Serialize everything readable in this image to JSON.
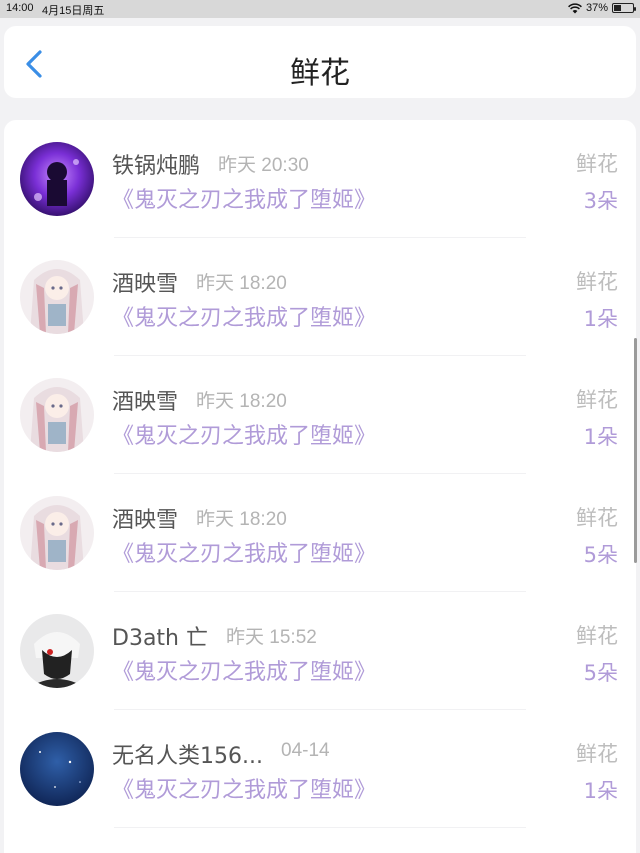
{
  "status_bar": {
    "time": "14:00",
    "date": "4月15日周五",
    "battery": "37%",
    "battery_level": 0.37
  },
  "header": {
    "title": "鲜花"
  },
  "entries": [
    {
      "name": "铁锅炖鹏",
      "time": "昨天 20:30",
      "book": "《鬼灭之刃之我成了堕姬》",
      "gift": "鲜花",
      "count": "3朵",
      "avatar_style": "purple-galaxy"
    },
    {
      "name": "酒映雪",
      "time": "昨天 18:20",
      "book": "《鬼灭之刃之我成了堕姬》",
      "gift": "鲜花",
      "count": "1朵",
      "avatar_style": "anime-girl"
    },
    {
      "name": "酒映雪",
      "time": "昨天 18:20",
      "book": "《鬼灭之刃之我成了堕姬》",
      "gift": "鲜花",
      "count": "1朵",
      "avatar_style": "anime-girl"
    },
    {
      "name": "酒映雪",
      "time": "昨天 18:20",
      "book": "《鬼灭之刃之我成了堕姬》",
      "gift": "鲜花",
      "count": "5朵",
      "avatar_style": "anime-girl"
    },
    {
      "name": "D3ath 亡",
      "time": "昨天 15:52",
      "book": "《鬼灭之刃之我成了堕姬》",
      "gift": "鲜花",
      "count": "5朵",
      "avatar_style": "dark-mask"
    },
    {
      "name": "无名人类156...",
      "time": "04-14",
      "book": "《鬼灭之刃之我成了堕姬》",
      "gift": "鲜花",
      "count": "1朵",
      "avatar_style": "night-sky"
    }
  ],
  "colors": {
    "accent": "#3a8ee6",
    "purple_text": "#b09bd8",
    "muted": "#bdbdbd"
  }
}
